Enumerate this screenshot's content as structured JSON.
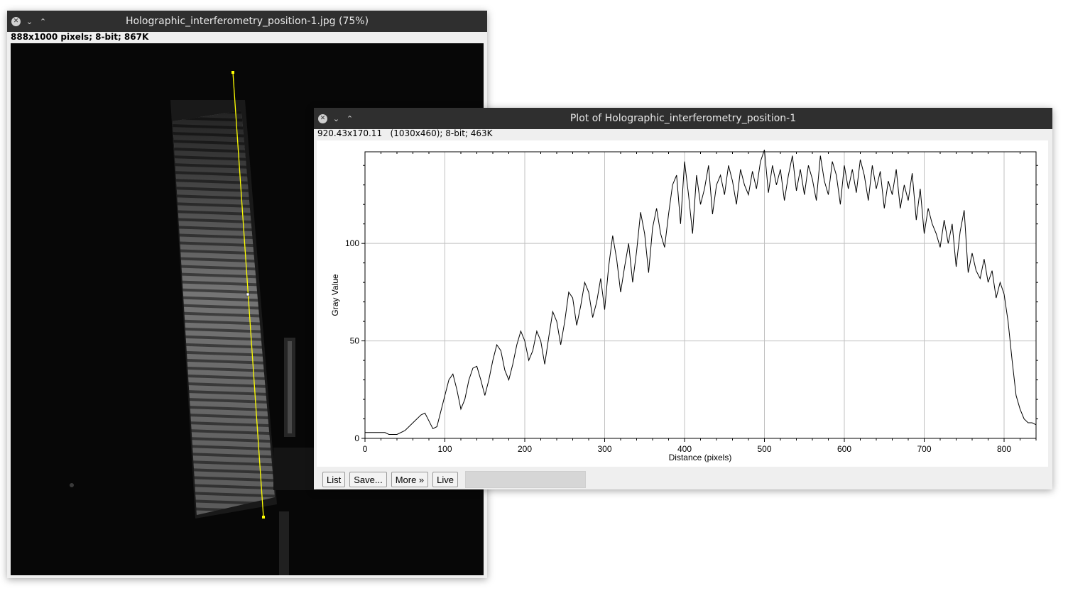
{
  "image_window": {
    "title": "Holographic_interferometry_position-1.jpg (75%)",
    "info": "888x1000 pixels; 8-bit; 867K"
  },
  "plot_window": {
    "title": "Plot of Holographic_interferometry_position-1",
    "info": "920.43x170.11   (1030x460); 8-bit; 463K",
    "buttons": {
      "list": "List",
      "save": "Save...",
      "more": "More »",
      "live": "Live"
    }
  },
  "colors": {
    "titlebar": "#2f2f2f",
    "line_selection": "#ffff00",
    "plot_line": "#000000",
    "grid": "#c0c0c0"
  },
  "icons": {
    "close": "close-icon",
    "minimize": "chevron-down-icon",
    "maximize": "chevron-up-icon"
  },
  "chart_data": {
    "type": "line",
    "xlabel": "Distance (pixels)",
    "ylabel": "Gray Value",
    "xlim": [
      0,
      840
    ],
    "ylim": [
      0,
      147
    ],
    "xticks": [
      0,
      100,
      200,
      300,
      400,
      500,
      600,
      700,
      800
    ],
    "yticks": [
      0,
      50,
      100
    ],
    "grid": true,
    "series": [
      {
        "x": [
          0,
          25,
          30,
          40,
          50,
          60,
          70,
          75,
          80,
          85,
          90,
          95,
          100,
          105,
          110,
          115,
          120,
          125,
          130,
          135,
          140,
          145,
          150,
          155,
          160,
          165,
          170,
          175,
          180,
          185,
          190,
          195,
          200,
          205,
          210,
          215,
          220,
          225,
          230,
          235,
          240,
          245,
          250,
          255,
          260,
          265,
          270,
          275,
          280,
          285,
          290,
          295,
          300,
          305,
          310,
          315,
          320,
          325,
          330,
          335,
          340,
          345,
          350,
          355,
          360,
          365,
          370,
          375,
          380,
          385,
          390,
          395,
          400,
          405,
          410,
          415,
          420,
          425,
          430,
          435,
          440,
          445,
          450,
          455,
          460,
          465,
          470,
          475,
          480,
          485,
          490,
          495,
          500,
          505,
          510,
          515,
          520,
          525,
          530,
          535,
          540,
          545,
          550,
          555,
          560,
          565,
          570,
          575,
          580,
          585,
          590,
          595,
          600,
          605,
          610,
          615,
          620,
          625,
          630,
          635,
          640,
          645,
          650,
          655,
          660,
          665,
          670,
          675,
          680,
          685,
          690,
          695,
          700,
          705,
          710,
          715,
          720,
          725,
          730,
          735,
          740,
          745,
          750,
          755,
          760,
          765,
          770,
          775,
          780,
          785,
          790,
          795,
          800,
          805,
          810,
          815,
          820,
          825,
          830,
          835,
          840
        ],
        "y": [
          3,
          3,
          2,
          2,
          4,
          8,
          12,
          13,
          9,
          5,
          6,
          14,
          22,
          30,
          33,
          25,
          15,
          20,
          30,
          36,
          37,
          30,
          22,
          30,
          40,
          48,
          45,
          35,
          30,
          38,
          48,
          55,
          50,
          40,
          45,
          55,
          50,
          38,
          52,
          65,
          60,
          48,
          60,
          75,
          72,
          58,
          68,
          80,
          75,
          62,
          70,
          82,
          66,
          88,
          104,
          92,
          75,
          88,
          100,
          80,
          96,
          116,
          105,
          85,
          108,
          118,
          105,
          98,
          115,
          130,
          135,
          110,
          142,
          125,
          105,
          135,
          120,
          128,
          140,
          115,
          130,
          135,
          125,
          140,
          132,
          120,
          138,
          130,
          125,
          137,
          128,
          142,
          148,
          126,
          140,
          130,
          138,
          122,
          135,
          145,
          127,
          138,
          125,
          140,
          133,
          122,
          145,
          132,
          125,
          142,
          135,
          120,
          140,
          128,
          138,
          126,
          143,
          135,
          122,
          140,
          128,
          137,
          118,
          132,
          125,
          138,
          118,
          130,
          122,
          136,
          112,
          128,
          105,
          118,
          110,
          105,
          98,
          112,
          100,
          110,
          88,
          106,
          117,
          85,
          95,
          86,
          82,
          92,
          80,
          86,
          72,
          80,
          74,
          60,
          40,
          22,
          15,
          10,
          8,
          8,
          7
        ]
      }
    ]
  }
}
